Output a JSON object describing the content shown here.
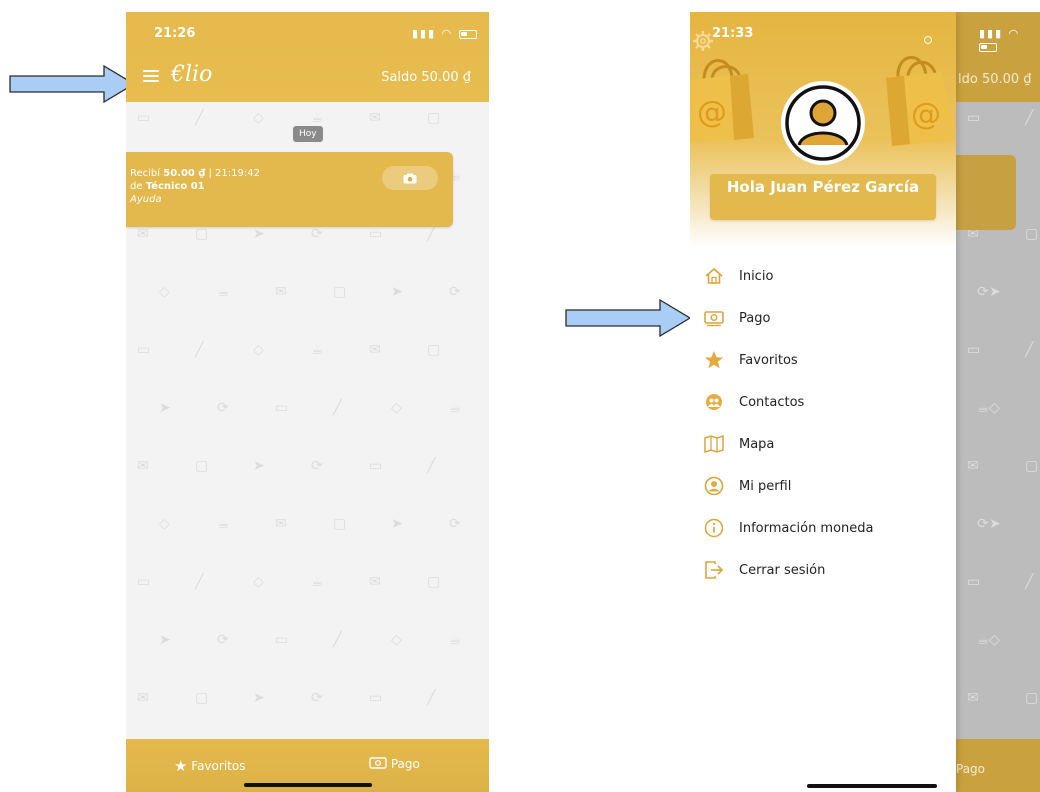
{
  "left_screen": {
    "status_time": "21:26",
    "app_logo": "€lio",
    "balance": "Saldo 50.00 ₫",
    "day_chip": "Hoy",
    "message": {
      "prefix": "Recibí",
      "amount": "50.00 ₫",
      "time_sep": " | 21:19:42",
      "from_prefix": "de",
      "from_name": "Técnico 01",
      "note": "Ayuda",
      "camera_icon": "camera-icon"
    },
    "footer": {
      "favorites_label": "Favoritos",
      "pay_label": "Pago"
    }
  },
  "right_screen": {
    "status_time": "21:33",
    "behind_balance": "ldo 50.00 ₫",
    "behind_footer_label": "Pago",
    "greeting": "Hola Juan Pérez García",
    "menu": [
      {
        "label": "Inicio",
        "icon": "home-icon"
      },
      {
        "label": "Pago",
        "icon": "banknote-icon"
      },
      {
        "label": "Favoritos",
        "icon": "star-icon"
      },
      {
        "label": "Contactos",
        "icon": "contacts-icon"
      },
      {
        "label": "Mapa",
        "icon": "map-icon"
      },
      {
        "label": "Mi perfil",
        "icon": "profile-icon"
      },
      {
        "label": "Información moneda",
        "icon": "info-icon"
      },
      {
        "label": "Cerrar sesión",
        "icon": "logout-icon"
      }
    ]
  },
  "colors": {
    "brand_gold": "#e5b94c",
    "arrow_fill": "#a9cdf5",
    "arrow_stroke": "#2a2a2a",
    "pattern_grey": "#dcdcdc"
  }
}
